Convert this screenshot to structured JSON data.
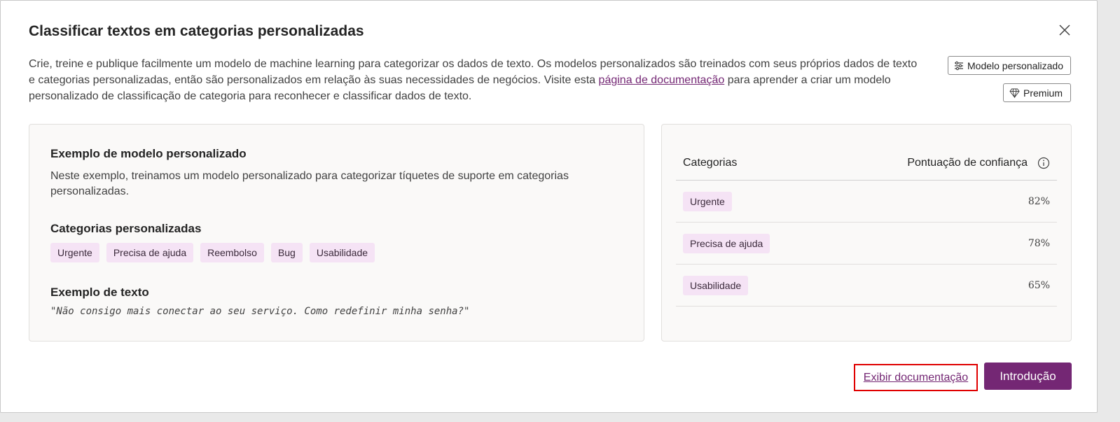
{
  "dialog": {
    "title": "Classificar textos em categorias personalizadas",
    "description_part1": "Crie, treine e publique facilmente um modelo de machine learning para categorizar os dados de texto. Os modelos personalizados são treinados com seus próprios dados de texto e categorias personalizadas, então são personalizados em relação às suas necessidades de negócios. Visite esta ",
    "description_link": "página de documentação",
    "description_part2": " para aprender a criar um modelo personalizado de classificação de categoria para reconhecer e classificar dados de texto.",
    "custom_model_label": "Modelo personalizado",
    "premium_label": "Premium",
    "close_icon": "close-icon"
  },
  "example": {
    "title": "Exemplo de modelo personalizado",
    "body": "Neste exemplo, treinamos um modelo personalizado para categorizar tíquetes de suporte em categorias personalizadas.",
    "categories_title": "Categorias personalizadas",
    "categories": [
      "Urgente",
      "Precisa de ajuda",
      "Reembolso",
      "Bug",
      "Usabilidade"
    ],
    "text_title": "Exemplo de texto",
    "text": "\"Não consigo mais conectar ao seu serviço. Como redefinir minha senha?\""
  },
  "results": {
    "col_category": "Categorias",
    "col_score": "Pontuação de confiança",
    "rows": [
      {
        "category": "Urgente",
        "score": "82%"
      },
      {
        "category": "Precisa de ajuda",
        "score": "78%"
      },
      {
        "category": "Usabilidade",
        "score": "65%"
      }
    ]
  },
  "footer": {
    "docs_link": "Exibir documentação",
    "primary_button": "Introdução"
  },
  "colors": {
    "accent": "#742774",
    "tag_bg": "#f5e3f5",
    "highlight_border": "#e00000"
  }
}
